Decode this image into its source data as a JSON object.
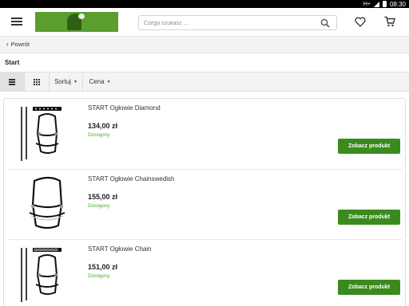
{
  "status_bar": {
    "network": "H+",
    "time": "08:30"
  },
  "header": {
    "search": {
      "placeholder": "Czego szukasz ..."
    }
  },
  "nav": {
    "back_label": "Powrót"
  },
  "category": {
    "title": "Start"
  },
  "toolbar": {
    "sort_label": "Sortuj",
    "price_label": "Cena"
  },
  "products": [
    {
      "name": "START Ogłowie Diamond",
      "price": "134,00 zł",
      "availability": "Dostępny",
      "button": "Zobacz produkt"
    },
    {
      "name": "START Ogłowie Chainswedish",
      "price": "155,00 zł",
      "availability": "Dostępny",
      "button": "Zobacz produkt"
    },
    {
      "name": "START Ogłowie Chain",
      "price": "151,00 zł",
      "availability": "Dostępny",
      "button": "Zobacz produkt"
    }
  ],
  "colors": {
    "accent": "#3b8a1e",
    "available": "#4fae3a",
    "logo": "#5a9e2e"
  }
}
